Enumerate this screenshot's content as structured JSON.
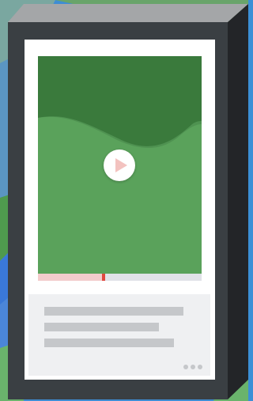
{
  "scene": {
    "description_icons": [
      "play-icon",
      "more-options-icon"
    ]
  },
  "video": {
    "progress": 0.4
  },
  "colors": {
    "device_frame": "#3a3f43",
    "device_top": "#a4a6a8",
    "device_side": "#232528",
    "video_light": "#5aa25b",
    "video_dark": "#3a7a3c",
    "progress_track": "#e1e2e8",
    "progress_fill": "#f3cccc",
    "progress_thumb": "#e0483f",
    "card_bg": "#eff0f2",
    "placeholder": "#c5c7ca"
  }
}
